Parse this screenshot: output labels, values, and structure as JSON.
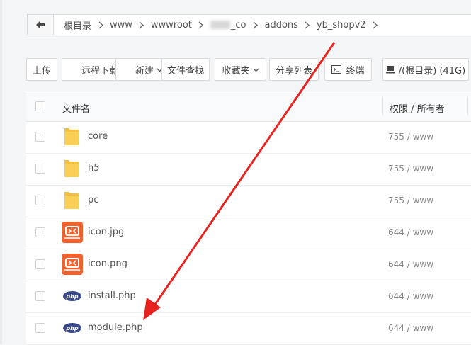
{
  "breadcrumb": {
    "items": [
      "根目录",
      "www",
      "wwwroot",
      "_co",
      "addons",
      "yb_shopv2"
    ]
  },
  "toolbar": {
    "upload": "上传",
    "remote_download": "远程下载",
    "new": "新建",
    "file_search": "文件查找",
    "favorites": "收藏夹",
    "share_list": "分享列表",
    "terminal": "终端",
    "disk": "/(根目录) (41G)"
  },
  "table": {
    "header_name": "文件名",
    "header_perm": "权限 / 所有者",
    "rows": [
      {
        "name": "core",
        "perm": "755 / www",
        "icon": "folder-icon"
      },
      {
        "name": "h5",
        "perm": "755 / www",
        "icon": "folder-icon"
      },
      {
        "name": "pc",
        "perm": "755 / www",
        "icon": "folder-icon"
      },
      {
        "name": "icon.jpg",
        "perm": "644 / www",
        "icon": "app-image-icon"
      },
      {
        "name": "icon.png",
        "perm": "644 / www",
        "icon": "app-image-icon"
      },
      {
        "name": "install.php",
        "perm": "644 / www",
        "icon": "php-icon"
      },
      {
        "name": "module.php",
        "perm": "644 / www",
        "icon": "php-icon"
      }
    ]
  },
  "colors": {
    "folder": "#f5c040",
    "php_badge": "#3b4a8a",
    "app_icon": "#f2622e",
    "annotation_arrow": "#e8231f"
  }
}
